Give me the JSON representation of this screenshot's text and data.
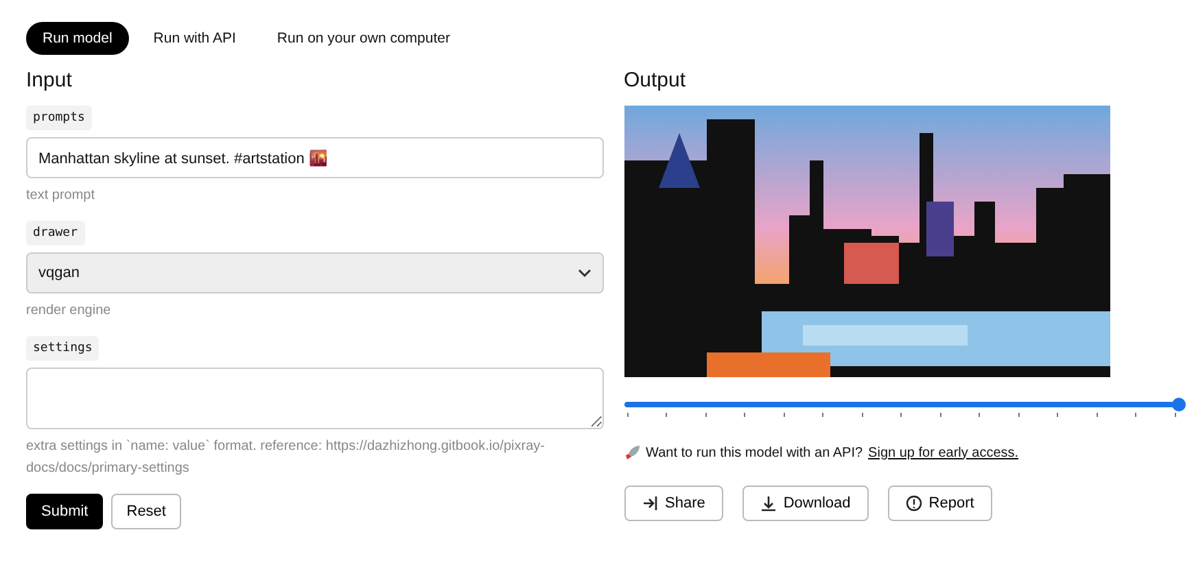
{
  "tabs": [
    {
      "label": "Run model",
      "selected": true
    },
    {
      "label": "Run with API",
      "selected": false
    },
    {
      "label": "Run on your own computer",
      "selected": false
    }
  ],
  "input": {
    "heading": "Input",
    "fields": [
      {
        "kind": "text",
        "label": "prompts",
        "value": "Manhattan skyline at sunset. #artstation 🌇",
        "hint": "text prompt"
      },
      {
        "kind": "select",
        "label": "drawer",
        "value": "vqgan",
        "hint": "render engine"
      },
      {
        "kind": "textarea",
        "label": "settings",
        "hint": "extra settings in `name: value` format. reference: https://dazhizhong.gitbook.io/pixray-docs/docs/primary-settings"
      }
    ],
    "buttons": [
      {
        "label": "Submit",
        "primary": true
      },
      {
        "label": "Reset",
        "primary": false
      }
    ]
  },
  "output": {
    "heading": "Output",
    "slider": {
      "level": 1
    },
    "api_note": {
      "text": "Want to run this model with an API?",
      "link": "Sign up for early access."
    },
    "buttons": [
      {
        "kind": "share",
        "label": "Share"
      },
      {
        "kind": "download",
        "label": "Download"
      },
      {
        "kind": "report",
        "label": "Report"
      }
    ]
  }
}
